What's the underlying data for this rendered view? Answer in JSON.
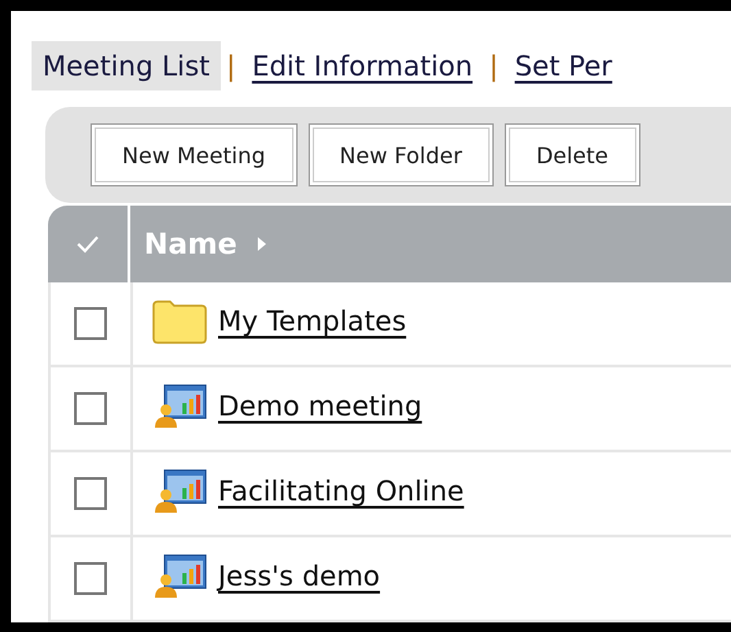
{
  "tabs": [
    {
      "label": "Meeting List",
      "selected": true
    },
    {
      "separator": "|",
      "label": "Edit Information",
      "selected": false
    },
    {
      "separator": "|",
      "label": "Set Per",
      "selected": false
    }
  ],
  "toolbar": {
    "buttons": [
      "New Meeting",
      "New Folder",
      "Delete"
    ]
  },
  "table": {
    "columns": [
      "Name"
    ],
    "rows": [
      {
        "kind": "folder",
        "name": "My Templates",
        "checked": false
      },
      {
        "kind": "meeting",
        "name": "Demo meeting",
        "checked": false
      },
      {
        "kind": "meeting",
        "name": "Facilitating Online",
        "checked": false
      },
      {
        "kind": "meeting",
        "name": "Jess's demo",
        "checked": false
      }
    ]
  }
}
